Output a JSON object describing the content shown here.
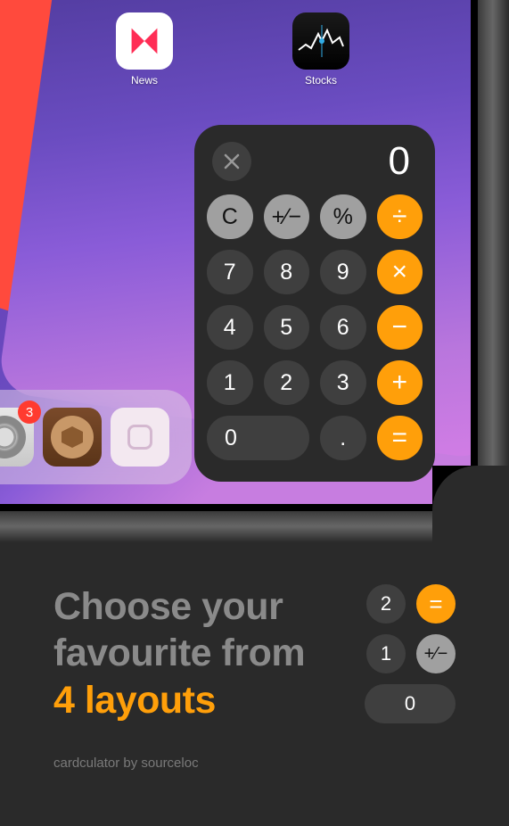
{
  "apps": {
    "news": {
      "label": "News"
    },
    "stocks": {
      "label": "Stocks"
    }
  },
  "dock": {
    "badge": "3"
  },
  "calc": {
    "display": "0",
    "buttons": {
      "clear": "C",
      "sign": "+⁄−",
      "percent": "%",
      "divide": "÷",
      "n7": "7",
      "n8": "8",
      "n9": "9",
      "multiply": "×",
      "n4": "4",
      "n5": "5",
      "n6": "6",
      "minus": "−",
      "n1": "1",
      "n2": "2",
      "n3": "3",
      "plus": "+",
      "n0": "0",
      "dot": ".",
      "equals": "="
    }
  },
  "promo": {
    "line1": "Choose your",
    "line2": "favourite from",
    "line3": "4 layouts",
    "credit": "cardculator by sourceloc"
  },
  "mini": {
    "r1a": "2",
    "r1b": "=",
    "r2a": "1",
    "r2b": "+⁄−",
    "r3": "0"
  }
}
